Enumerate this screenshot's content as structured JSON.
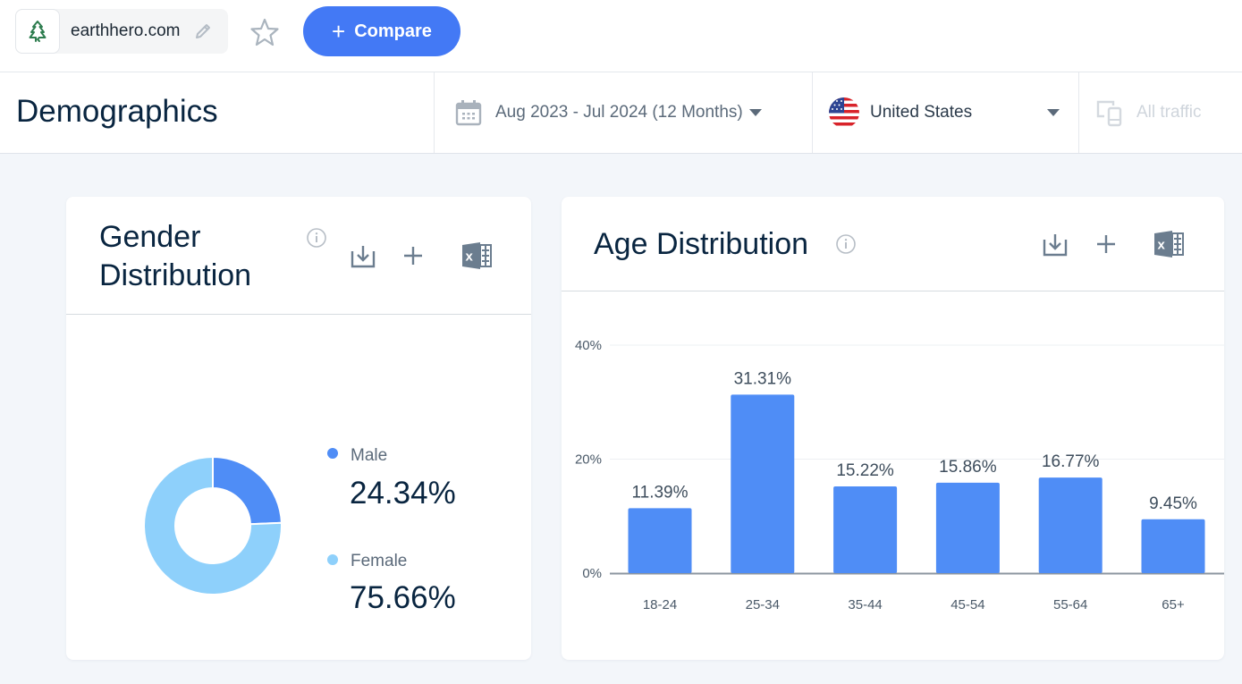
{
  "topbar": {
    "site_name": "earthhero.com",
    "site_logo_icon": "recycle-tree-icon",
    "edit_icon": "pencil-icon",
    "favorite_icon": "star-outline-icon",
    "compare_label": "Compare",
    "compare_icon": "plus-icon"
  },
  "header": {
    "title": "Demographics",
    "date_filter": {
      "icon": "calendar-icon",
      "value": "Aug 2023 - Jul 2024 (12 Months)"
    },
    "country_filter": {
      "icon": "us-flag-icon",
      "value": "United States"
    },
    "traffic_filter": {
      "icon": "devices-icon",
      "value": "All traffic",
      "disabled": true
    }
  },
  "colors": {
    "accent": "#4379f5",
    "male": "#4f8df6",
    "female": "#8ed0fb",
    "bar": "#4f8df6",
    "title": "#092540"
  },
  "gender_card": {
    "title": "Gender Distribution",
    "tools": [
      "download-icon",
      "add-icon",
      "excel-icon"
    ],
    "legend": [
      {
        "label": "Male",
        "value": "24.34%"
      },
      {
        "label": "Female",
        "value": "75.66%"
      }
    ]
  },
  "age_card": {
    "title": "Age Distribution",
    "tools": [
      "download-icon",
      "add-icon",
      "excel-icon"
    ]
  },
  "chart_data": [
    {
      "type": "pie",
      "title": "Gender Distribution",
      "donut": true,
      "categories": [
        "Male",
        "Female"
      ],
      "values": [
        24.34,
        75.66
      ],
      "legend": "right"
    },
    {
      "type": "bar",
      "title": "Age Distribution",
      "categories": [
        "18-24",
        "25-34",
        "35-44",
        "45-54",
        "55-64",
        "65+"
      ],
      "values": [
        11.39,
        31.31,
        15.22,
        15.86,
        16.77,
        9.45
      ],
      "value_labels": [
        "11.39%",
        "31.31%",
        "15.22%",
        "15.86%",
        "16.77%",
        "9.45%"
      ],
      "y_ticks": [
        "0%",
        "20%",
        "40%"
      ],
      "y_tick_values": [
        0,
        20,
        40
      ],
      "ylim": [
        0,
        40
      ],
      "xlabel": "",
      "ylabel": "",
      "grid": true
    }
  ]
}
